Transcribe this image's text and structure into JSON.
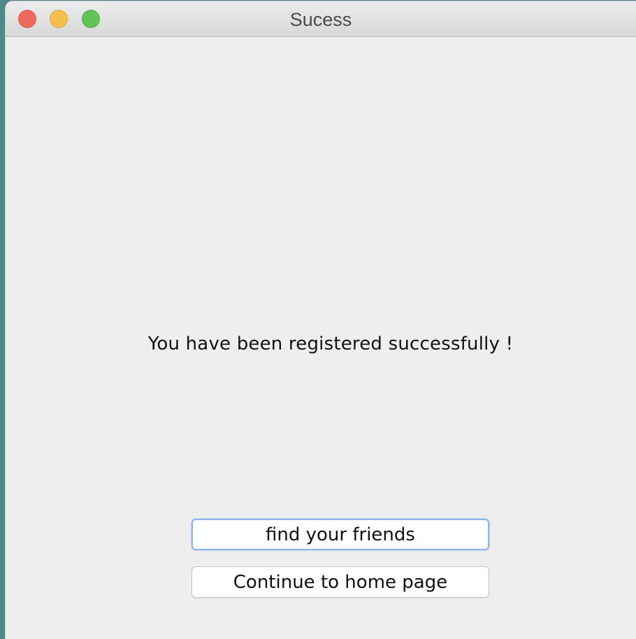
{
  "window": {
    "title": "Sucess"
  },
  "message": {
    "text": "You have been registered successfully !"
  },
  "buttons": {
    "find_friends": "find your friends",
    "continue_home": "Continue to home page"
  },
  "colors": {
    "close": "#ee6a5f",
    "minimize": "#f5bf4f",
    "zoom": "#62c454",
    "focus_ring": "#8bb4ec",
    "window_bg": "#eeeeee",
    "desktop_bg": "#4f8a8b"
  },
  "icons": {
    "close": "close-icon",
    "minimize": "minimize-icon",
    "zoom": "zoom-icon"
  }
}
